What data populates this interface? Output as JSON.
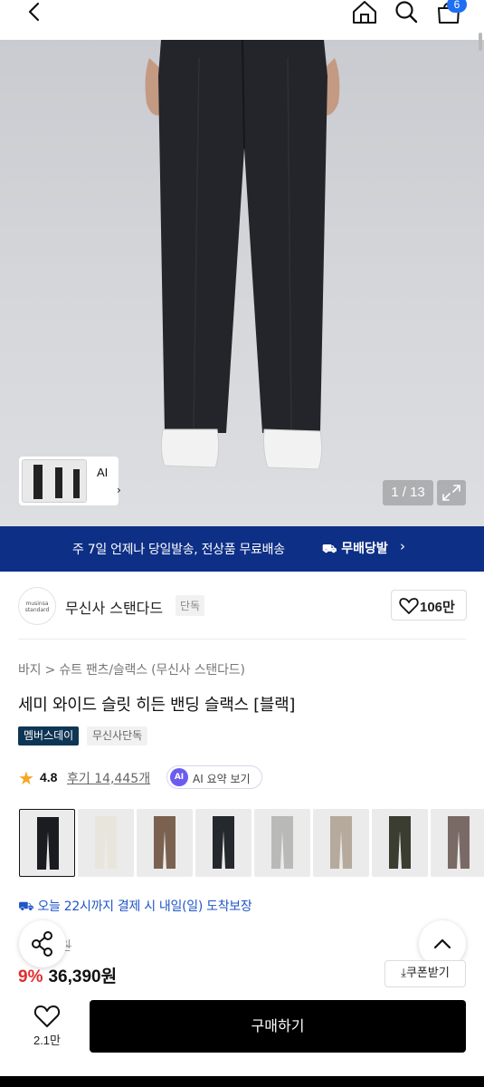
{
  "header": {
    "cart_count": "6",
    "icons": [
      "back-icon",
      "home-icon",
      "search-icon",
      "cart-icon"
    ]
  },
  "hero": {
    "thumb_label": "AI",
    "counter": "1 / 13"
  },
  "banner": {
    "text": "주 7일 언제나 당일발송, 전상품 무료배송",
    "tag": "무배당발"
  },
  "brand": {
    "logo_text": "musinsa standard",
    "name": "무신사 스탠다드",
    "tag": "단독",
    "likes": "106만"
  },
  "product": {
    "breadcrumb": "바지 > 슈트 팬츠/슬랙스 (무신사 스탠다드)",
    "title": "세미 와이드 슬릿 히든 밴딩 슬랙스 [블랙]",
    "tags": [
      "멤버스데이",
      "무신사단독"
    ],
    "rating": "4.8",
    "reviews": "후기 14,445개",
    "ai_summary_label": "AI 요약 보기",
    "ai_badge": "AI",
    "colors": [
      "#1b1c20",
      "#e8e5dc",
      "#7b6250",
      "#25282d",
      "#b9bab8",
      "#b5aa9c",
      "#3a3d30",
      "#7a6a66"
    ],
    "delivery": "오늘 22시까지 결제 시 내일(일) 도착보장",
    "original_price": "원",
    "discount": "9%",
    "price": "36,390원",
    "coupon": "쿠폰받기"
  },
  "bottom": {
    "wishlist_count": "2.1만",
    "buy_label": "구매하기"
  }
}
